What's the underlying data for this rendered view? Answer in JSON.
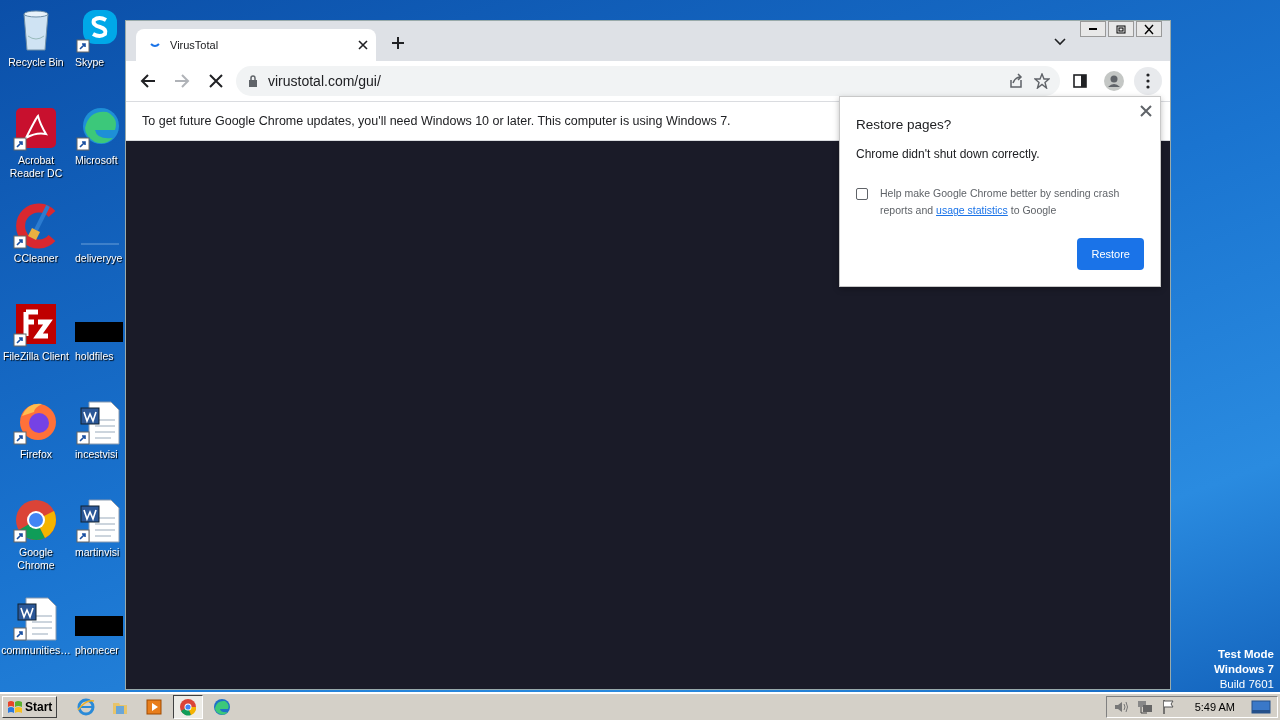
{
  "desktop": {
    "icons": [
      {
        "label": "Recycle Bin",
        "kind": "recycle"
      },
      {
        "label": "Skype",
        "kind": "skype"
      },
      {
        "label": "Acrobat Reader DC",
        "kind": "acrobat"
      },
      {
        "label": "Microsoft",
        "kind": "edge"
      },
      {
        "label": "CCleaner",
        "kind": "ccleaner"
      },
      {
        "label": "deliveryye",
        "kind": "blank"
      },
      {
        "label": "FileZilla Client",
        "kind": "filezilla"
      },
      {
        "label": "holdfiles",
        "kind": "black"
      },
      {
        "label": "Firefox",
        "kind": "firefox"
      },
      {
        "label": "incestvisi",
        "kind": "word"
      },
      {
        "label": "Google Chrome",
        "kind": "chrome"
      },
      {
        "label": "martinvisi",
        "kind": "word"
      },
      {
        "label": "communities…",
        "kind": "word"
      },
      {
        "label": "phonecer",
        "kind": "black"
      }
    ],
    "system_text": [
      "Test Mode",
      "Windows 7",
      "Build 7601"
    ]
  },
  "browser": {
    "tabs": [
      {
        "title": "VirusTotal",
        "selected": true,
        "loading": true
      }
    ],
    "forward_enabled": false,
    "loading": true,
    "address": "virustotal.com/gui/",
    "infobar": "To get future Google Chrome updates, you'll need Windows 10 or later. This computer is using Windows 7."
  },
  "restore_dialog": {
    "title": "Restore pages?",
    "message": "Chrome didn't shut down correctly.",
    "checkbox": {
      "checked": false,
      "text_before": "Help make Google Chrome better by sending crash reports and",
      "link": "usage statistics",
      "text_after": "to Google"
    },
    "button": "Restore"
  },
  "taskbar": {
    "start": "Start",
    "apps": [
      {
        "kind": "ie",
        "selected": false
      },
      {
        "kind": "explorer",
        "selected": false
      },
      {
        "kind": "media",
        "selected": false
      },
      {
        "kind": "chrome",
        "selected": true
      },
      {
        "kind": "edge",
        "selected": false
      }
    ],
    "clock": "5:49 AM"
  }
}
